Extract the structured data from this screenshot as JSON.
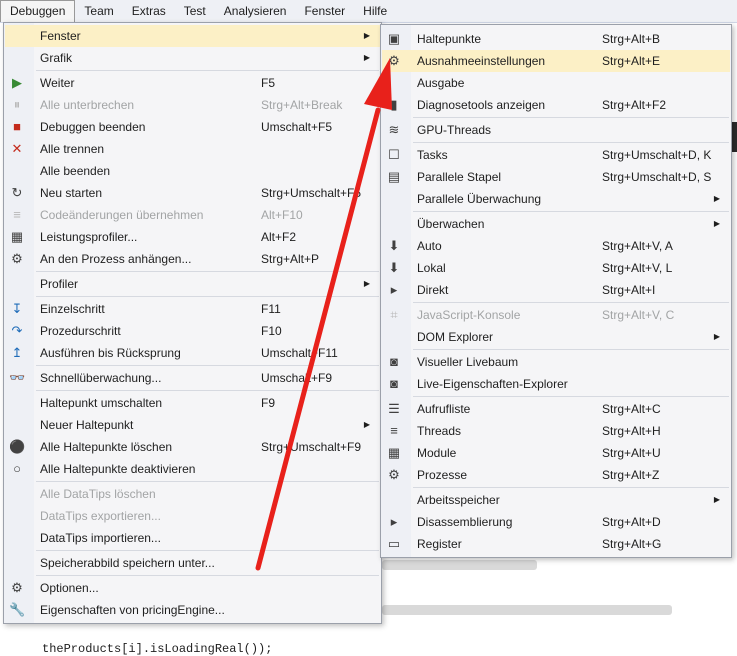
{
  "menubar": [
    "Debuggen",
    "Team",
    "Extras",
    "Test",
    "Analysieren",
    "Fenster",
    "Hilfe"
  ],
  "background": {
    "code_fragment": "theProducts[i].isLoadingReal());"
  },
  "debug_menu": {
    "items": [
      {
        "label": "Fenster",
        "shortcut": "",
        "icon": "",
        "submenu": true,
        "highlight": true
      },
      {
        "label": "Grafik",
        "shortcut": "",
        "icon": "",
        "submenu": true
      },
      {
        "sep": true
      },
      {
        "label": "Weiter",
        "shortcut": "F5",
        "icon": "play-icon",
        "color": "#388a34"
      },
      {
        "label": "Alle unterbrechen",
        "shortcut": "Strg+Alt+Break",
        "icon": "pause-icon",
        "disabled": true
      },
      {
        "label": "Debuggen beenden",
        "shortcut": "Umschalt+F5",
        "icon": "stop-icon",
        "color": "#c42b1c"
      },
      {
        "label": "Alle trennen",
        "shortcut": "",
        "icon": "close-icon",
        "color": "#c42b1c"
      },
      {
        "label": "Alle beenden",
        "shortcut": "",
        "icon": ""
      },
      {
        "label": "Neu starten",
        "shortcut": "Strg+Umschalt+F5",
        "icon": "restart-icon"
      },
      {
        "label": "Codeänderungen übernehmen",
        "shortcut": "Alt+F10",
        "icon": "apply-changes-icon",
        "disabled": true
      },
      {
        "label": "Leistungsprofiler...",
        "shortcut": "Alt+F2",
        "icon": "profiler-icon"
      },
      {
        "label": "An den Prozess anhängen...",
        "shortcut": "Strg+Alt+P",
        "icon": "gears-icon"
      },
      {
        "sep": true
      },
      {
        "label": "Profiler",
        "shortcut": "",
        "icon": "",
        "submenu": true
      },
      {
        "sep": true
      },
      {
        "label": "Einzelschritt",
        "shortcut": "F11",
        "icon": "step-into-icon",
        "color": "#1e6bb8"
      },
      {
        "label": "Prozedurschritt",
        "shortcut": "F10",
        "icon": "step-over-icon",
        "color": "#1e6bb8"
      },
      {
        "label": "Ausführen bis Rücksprung",
        "shortcut": "Umschalt+F11",
        "icon": "step-out-icon",
        "color": "#1e6bb8"
      },
      {
        "sep": true
      },
      {
        "label": "Schnellüberwachung...",
        "shortcut": "Umschalt+F9",
        "icon": "glasses-icon"
      },
      {
        "sep": true
      },
      {
        "label": "Haltepunkt umschalten",
        "shortcut": "F9",
        "icon": ""
      },
      {
        "label": "Neuer Haltepunkt",
        "shortcut": "",
        "icon": "",
        "submenu": true
      },
      {
        "label": "Alle Haltepunkte löschen",
        "shortcut": "Strg+Umschalt+F9",
        "icon": "delete-breakpoints-icon",
        "color": "#c42b1c"
      },
      {
        "label": "Alle Haltepunkte deaktivieren",
        "shortcut": "",
        "icon": "disable-breakpoints-icon"
      },
      {
        "sep": true
      },
      {
        "label": "Alle DataTips löschen",
        "shortcut": "",
        "icon": "",
        "disabled": true
      },
      {
        "label": "DataTips exportieren...",
        "shortcut": "",
        "icon": "",
        "disabled": true
      },
      {
        "label": "DataTips importieren...",
        "shortcut": "",
        "icon": ""
      },
      {
        "sep": true
      },
      {
        "label": "Speicherabbild speichern unter...",
        "shortcut": "",
        "icon": ""
      },
      {
        "sep": true
      },
      {
        "label": "Optionen...",
        "shortcut": "",
        "icon": "gear-icon"
      },
      {
        "label": "Eigenschaften von pricingEngine...",
        "shortcut": "",
        "icon": "wrench-icon"
      }
    ]
  },
  "fenster_submenu": {
    "items": [
      {
        "label": "Haltepunkte",
        "shortcut": "Strg+Alt+B",
        "icon": "breakpoints-window-icon"
      },
      {
        "label": "Ausnahmeeinstellungen",
        "shortcut": "Strg+Alt+E",
        "icon": "exception-settings-icon",
        "highlight": true
      },
      {
        "label": "Ausgabe",
        "shortcut": "",
        "icon": ""
      },
      {
        "label": "Diagnosetools anzeigen",
        "shortcut": "Strg+Alt+F2",
        "icon": "diagnostic-tools-icon"
      },
      {
        "sep": true
      },
      {
        "label": "GPU-Threads",
        "shortcut": "",
        "icon": "gpu-threads-icon"
      },
      {
        "sep": true
      },
      {
        "label": "Tasks",
        "shortcut": "Strg+Umschalt+D, K",
        "icon": "tasks-icon"
      },
      {
        "label": "Parallele Stapel",
        "shortcut": "Strg+Umschalt+D, S",
        "icon": "parallel-stacks-icon"
      },
      {
        "label": "Parallele Überwachung",
        "shortcut": "",
        "icon": "",
        "submenu": true
      },
      {
        "sep": true
      },
      {
        "label": "Überwachen",
        "shortcut": "",
        "icon": "",
        "submenu": true
      },
      {
        "label": "Auto",
        "shortcut": "Strg+Alt+V, A",
        "icon": "autos-icon"
      },
      {
        "label": "Lokal",
        "shortcut": "Strg+Alt+V, L",
        "icon": "locals-icon"
      },
      {
        "label": "Direkt",
        "shortcut": "Strg+Alt+I",
        "icon": "immediate-icon"
      },
      {
        "sep": true
      },
      {
        "label": "JavaScript-Konsole",
        "shortcut": "Strg+Alt+V, C",
        "icon": "js-console-icon",
        "disabled": true
      },
      {
        "label": "DOM Explorer",
        "shortcut": "",
        "icon": "",
        "submenu": true
      },
      {
        "sep": true
      },
      {
        "label": "Visueller Livebaum",
        "shortcut": "",
        "icon": "camera-icon"
      },
      {
        "label": "Live-Eigenschaften-Explorer",
        "shortcut": "",
        "icon": "camera-icon"
      },
      {
        "sep": true
      },
      {
        "label": "Aufrufliste",
        "shortcut": "Strg+Alt+C",
        "icon": "call-stack-icon"
      },
      {
        "label": "Threads",
        "shortcut": "Strg+Alt+H",
        "icon": "threads-icon"
      },
      {
        "label": "Module",
        "shortcut": "Strg+Alt+U",
        "icon": "modules-icon"
      },
      {
        "label": "Prozesse",
        "shortcut": "Strg+Alt+Z",
        "icon": "processes-icon"
      },
      {
        "sep": true
      },
      {
        "label": "Arbeitsspeicher",
        "shortcut": "",
        "icon": "",
        "submenu": true
      },
      {
        "label": "Disassemblierung",
        "shortcut": "Strg+Alt+D",
        "icon": "disassembly-icon"
      },
      {
        "label": "Register",
        "shortcut": "Strg+Alt+G",
        "icon": "registers-icon"
      }
    ]
  },
  "icon_glyphs": {
    "play-icon": "▶",
    "pause-icon": "⏸",
    "stop-icon": "■",
    "close-icon": "✕",
    "restart-icon": "↻",
    "apply-changes-icon": "≡",
    "profiler-icon": "▦",
    "gears-icon": "⚙",
    "step-into-icon": "↧",
    "step-over-icon": "↷",
    "step-out-icon": "↥",
    "glasses-icon": "👓",
    "delete-breakpoints-icon": "⚫",
    "disable-breakpoints-icon": "○",
    "gear-icon": "⚙",
    "wrench-icon": "🔧",
    "breakpoints-window-icon": "▣",
    "exception-settings-icon": "⚙",
    "diagnostic-tools-icon": "▮",
    "gpu-threads-icon": "≋",
    "tasks-icon": "☐",
    "parallel-stacks-icon": "▤",
    "autos-icon": "⬇",
    "locals-icon": "⬇",
    "immediate-icon": "▸",
    "js-console-icon": "⌗",
    "camera-icon": "◙",
    "call-stack-icon": "☰",
    "threads-icon": "≡",
    "modules-icon": "▦",
    "processes-icon": "⚙",
    "disassembly-icon": "▸",
    "registers-icon": "▭"
  },
  "accent": {
    "highlight": "#fcf0c6",
    "annotation_arrow": "#e8211b"
  }
}
